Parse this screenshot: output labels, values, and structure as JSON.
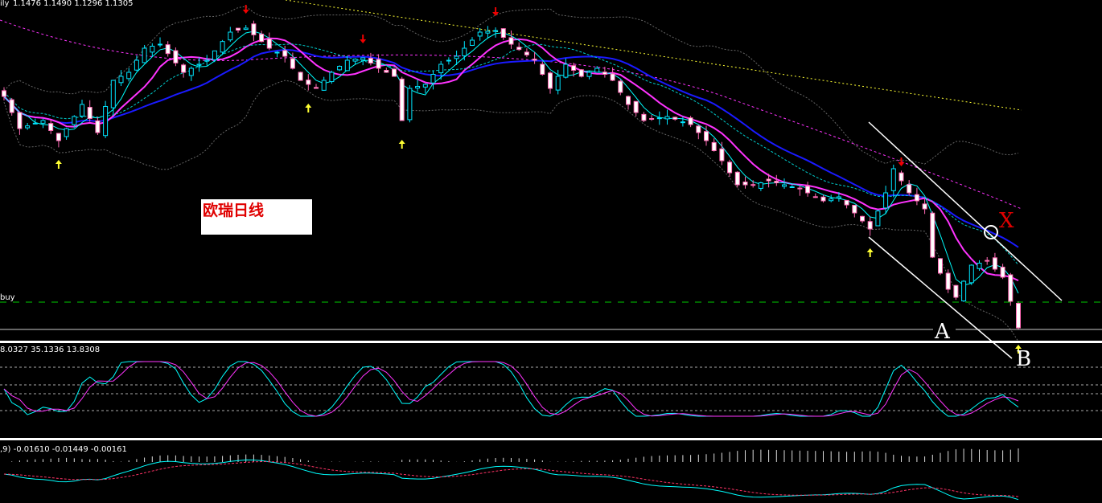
{
  "header": {
    "period_suffix": "ily",
    "ohlc": "1.1476 1.1490 1.1296 1.1305"
  },
  "annotation_label": "欧瑞日线",
  "buy_line_label": "buy",
  "markers": {
    "a": "A",
    "b": "B",
    "x": "X"
  },
  "stoch_panel": {
    "values_text": "8.0327 35.1336 13.8308"
  },
  "macd_panel": {
    "values_text": ",9) -0.01610 -0.01449 -0.00161"
  },
  "colors": {
    "bg": "#000000",
    "bull": "#00e5ff",
    "bear": "#ff69b4",
    "ma_slow": "#1a1aff",
    "ma_mid": "#ff33ff",
    "ma_fast": "#00ffff",
    "yellow": "#ffff33",
    "buy_line": "#00cc00"
  },
  "chart_data": {
    "type": "candlestick",
    "title": "EURUSD Daily",
    "bars": 131,
    "close_keypoints": [
      [
        0,
        1.2918
      ],
      [
        2,
        1.2694
      ],
      [
        5,
        1.275
      ],
      [
        7,
        1.261
      ],
      [
        10,
        1.2862
      ],
      [
        12,
        1.2666
      ],
      [
        14,
        1.303
      ],
      [
        16,
        1.3086
      ],
      [
        18,
        1.3254
      ],
      [
        20,
        1.3282
      ],
      [
        23,
        1.3086
      ],
      [
        26,
        1.317
      ],
      [
        29,
        1.3366
      ],
      [
        31,
        1.3394
      ],
      [
        34,
        1.3254
      ],
      [
        36,
        1.3198
      ],
      [
        38,
        1.303
      ],
      [
        40,
        1.2974
      ],
      [
        42,
        1.3086
      ],
      [
        44,
        1.317
      ],
      [
        46,
        1.3187
      ],
      [
        48,
        1.3114
      ],
      [
        50,
        1.3058
      ],
      [
        51,
        1.275
      ],
      [
        52,
        1.2974
      ],
      [
        54,
        1.3002
      ],
      [
        56,
        1.3142
      ],
      [
        58,
        1.3198
      ],
      [
        61,
        1.3366
      ],
      [
        63,
        1.3377
      ],
      [
        65,
        1.3282
      ],
      [
        68,
        1.317
      ],
      [
        70,
        1.2974
      ],
      [
        72,
        1.3142
      ],
      [
        74,
        1.3058
      ],
      [
        76,
        1.3114
      ],
      [
        78,
        1.303
      ],
      [
        80,
        1.2862
      ],
      [
        82,
        1.275
      ],
      [
        85,
        1.2778
      ],
      [
        88,
        1.2722
      ],
      [
        90,
        1.261
      ],
      [
        92,
        1.247
      ],
      [
        94,
        1.2302
      ],
      [
        96,
        1.2302
      ],
      [
        98,
        1.233
      ],
      [
        102,
        1.2274
      ],
      [
        105,
        1.219
      ],
      [
        107,
        1.2218
      ],
      [
        109,
        1.2106
      ],
      [
        111,
        1.1994
      ],
      [
        113,
        1.2246
      ],
      [
        114,
        1.2414
      ],
      [
        116,
        1.2246
      ],
      [
        118,
        1.2134
      ],
      [
        119,
        1.1798
      ],
      [
        121,
        1.1574
      ],
      [
        122,
        1.1518
      ],
      [
        124,
        1.1742
      ],
      [
        126,
        1.177
      ],
      [
        128,
        1.1658
      ],
      [
        130,
        1.1322
      ]
    ],
    "last_bar": {
      "open": 1.1476,
      "high": 1.149,
      "low": 1.1296,
      "close": 1.1305
    },
    "buy_arrows": [
      7,
      39,
      51,
      111,
      130
    ],
    "sell_arrows": [
      31,
      46,
      63,
      115
    ],
    "ylim": [
      1.12,
      1.36
    ]
  }
}
